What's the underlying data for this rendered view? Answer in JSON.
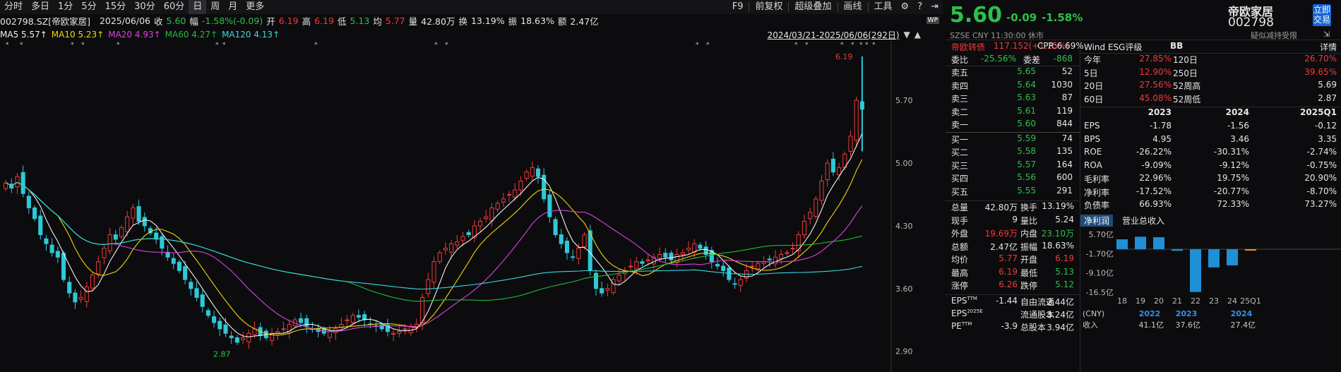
{
  "toolbar": {
    "left": [
      "分时",
      "多日",
      "1分",
      "5分",
      "15分",
      "30分",
      "60分",
      "日",
      "周",
      "月",
      "更多"
    ],
    "active": "日",
    "right": [
      "F9",
      "前复权",
      "超级叠加",
      "画线",
      "工具"
    ]
  },
  "info": {
    "code": "002798.SZ[帝欧家居]",
    "date": "2025/06/06",
    "close_label": "收",
    "close": "5.60",
    "change_label": "幅",
    "change": "-1.58%(-0.09)",
    "open_label": "开",
    "open": "6.19",
    "high_label": "高",
    "high": "6.19",
    "low_label": "低",
    "low": "5.13",
    "avg_label": "均",
    "avg": "5.77",
    "vol_label": "量",
    "vol": "42.80万",
    "turn_label": "换",
    "turn": "13.19%",
    "amp_label": "振",
    "amp": "18.63%",
    "amt_label": "额",
    "amt": "2.47亿"
  },
  "ma": {
    "ma5": "MA5 5.57↑",
    "ma10": "MA10 5.23↑",
    "ma20": "MA20 4.93↑",
    "ma60": "MA60 4.27↑",
    "ma120": "MA120 4.13↑",
    "range": "2024/03/21-2025/06/06(292日)",
    "colors": {
      "ma5": "#f2f2f2",
      "ma10": "#f5d50a",
      "ma20": "#e040e0",
      "ma60": "#1fbf3a",
      "ma120": "#3ad6e0"
    }
  },
  "chart_data": {
    "type": "candlestick",
    "y_ticks": [
      "5.70",
      "5.00",
      "4.30",
      "3.60",
      "2.90"
    ],
    "ylim": [
      2.7,
      6.3
    ],
    "high_label": "6.19",
    "low_label": "2.87",
    "closes": [
      4.78,
      4.72,
      4.85,
      4.66,
      4.5,
      4.38,
      4.2,
      4.1,
      4.0,
      3.95,
      3.7,
      3.55,
      3.45,
      3.5,
      3.62,
      3.75,
      3.9,
      4.05,
      4.2,
      4.15,
      4.28,
      4.4,
      4.5,
      4.35,
      4.3,
      4.22,
      4.15,
      4.05,
      3.95,
      3.88,
      3.8,
      3.7,
      3.6,
      3.5,
      3.4,
      3.3,
      3.22,
      3.15,
      3.1,
      3.05,
      3.0,
      3.05,
      3.1,
      3.15,
      3.08,
      3.05,
      3.1,
      3.12,
      3.15,
      3.2,
      3.25,
      3.22,
      3.18,
      3.15,
      3.12,
      3.1,
      3.12,
      3.15,
      3.2,
      3.25,
      3.3,
      3.28,
      3.25,
      3.2,
      3.18,
      3.15,
      3.12,
      3.1,
      3.12,
      3.15,
      3.18,
      3.2,
      3.5,
      3.7,
      3.9,
      4.0,
      4.05,
      4.1,
      4.12,
      4.18,
      4.2,
      4.3,
      4.35,
      4.4,
      4.5,
      4.55,
      4.6,
      4.65,
      4.7,
      4.8,
      4.9,
      4.95,
      4.85,
      4.6,
      4.4,
      4.2,
      4.1,
      4.0,
      3.95,
      4.05,
      4.2,
      3.8,
      3.6,
      3.55,
      3.6,
      3.7,
      3.75,
      3.8,
      3.85,
      3.9,
      3.88,
      3.92,
      3.95,
      3.98,
      3.95,
      3.92,
      3.98,
      4.0,
      4.05,
      4.1,
      4.05,
      3.98,
      3.9,
      3.85,
      3.8,
      3.7,
      3.65,
      3.7,
      3.8,
      3.85,
      3.88,
      3.9,
      3.92,
      3.95,
      3.98,
      4.0,
      4.05,
      4.2,
      4.35,
      4.45,
      4.6,
      4.8,
      5.0,
      4.9,
      4.95,
      5.1,
      5.3,
      5.7,
      5.6
    ],
    "series": [
      {
        "name": "MA5",
        "color": "#f2f2f2"
      },
      {
        "name": "MA10",
        "color": "#f5d50a"
      },
      {
        "name": "MA20",
        "color": "#e040e0"
      },
      {
        "name": "MA60",
        "color": "#1fbf3a"
      },
      {
        "name": "MA120",
        "color": "#3ad6e0"
      }
    ]
  },
  "quote": {
    "name": "帝欧家居",
    "code": "002798",
    "price": "5.60",
    "change": "-0.09",
    "pct": "-1.58%",
    "meta": "SZSE  CNY  11:30:00  休市",
    "notice": "疑似减持受限",
    "trade_btn": "立即交易"
  },
  "book": {
    "bond_label": "帝欧转债",
    "bond_val": "117.152(+1.25%)",
    "cpr": "CPR:6.69%",
    "webi_label": "委比",
    "webi": "-25.56%",
    "weicha_label": "委差",
    "weicha": "-868",
    "asks": [
      {
        "label": "卖五",
        "price": "5.65",
        "vol": "52"
      },
      {
        "label": "卖四",
        "price": "5.64",
        "vol": "1030"
      },
      {
        "label": "卖三",
        "price": "5.63",
        "vol": "87"
      },
      {
        "label": "卖二",
        "price": "5.61",
        "vol": "119"
      },
      {
        "label": "卖一",
        "price": "5.60",
        "vol": "844"
      }
    ],
    "bids": [
      {
        "label": "买一",
        "price": "5.59",
        "vol": "74"
      },
      {
        "label": "买二",
        "price": "5.58",
        "vol": "135"
      },
      {
        "label": "买三",
        "price": "5.57",
        "vol": "164"
      },
      {
        "label": "买四",
        "price": "5.56",
        "vol": "600"
      },
      {
        "label": "买五",
        "price": "5.55",
        "vol": "291"
      }
    ]
  },
  "stats": [
    {
      "l": "总量",
      "v": "42.80万",
      "vc": "white",
      "l2": "换手",
      "v2": "13.19%",
      "v2c": "white"
    },
    {
      "l": "现手",
      "v": "9",
      "vc": "white",
      "l2": "量比",
      "v2": "5.24",
      "v2c": "white"
    },
    {
      "l": "外盘",
      "v": "19.69万",
      "vc": "red",
      "l2": "内盘",
      "v2": "23.10万",
      "v2c": "green"
    },
    {
      "l": "总额",
      "v": "2.47亿",
      "vc": "white",
      "l2": "振幅",
      "v2": "18.63%",
      "v2c": "white"
    },
    {
      "l": "均价",
      "v": "5.77",
      "vc": "red",
      "l2": "开盘",
      "v2": "6.19",
      "v2c": "red"
    },
    {
      "l": "最高",
      "v": "6.19",
      "vc": "red",
      "l2": "最低",
      "v2": "5.13",
      "v2c": "green"
    },
    {
      "l": "涨停",
      "v": "6.26",
      "vc": "red",
      "l2": "跌停",
      "v2": "5.12",
      "v2c": "green"
    }
  ],
  "eps_block": [
    {
      "l": "EPS",
      "sup": "TTM",
      "v": "-1.44",
      "l2": "自由流通",
      "v2": "2.44亿"
    },
    {
      "l": "EPS",
      "sup": "2025E",
      "v": "",
      "l2": "流通股本",
      "v2": "3.24亿"
    },
    {
      "l": "PE",
      "sup": "TTM",
      "v": "-3.9",
      "l2": "总股本",
      "v2": "3.94亿"
    }
  ],
  "esg": {
    "label": "Wind ESG评级",
    "rating": "BB",
    "detail": "详情"
  },
  "perf": [
    {
      "l": "今年",
      "v": "27.85%",
      "l2": "120日",
      "v2": "26.70%",
      "c2": "red"
    },
    {
      "l": "5日",
      "v": "12.90%",
      "l2": "250日",
      "v2": "39.65%",
      "c2": "red"
    },
    {
      "l": "20日",
      "v": "27.56%",
      "l2": "52周高",
      "v2": "5.69",
      "c2": "white"
    },
    {
      "l": "60日",
      "v": "45.08%",
      "l2": "52周低",
      "v2": "2.87",
      "c2": "white"
    }
  ],
  "fin": {
    "headers": [
      "2023",
      "2024",
      "2025Q1"
    ],
    "rows": [
      {
        "l": "EPS",
        "v": [
          "-1.78",
          "-1.56",
          "-0.12"
        ]
      },
      {
        "l": "BPS",
        "v": [
          "4.95",
          "3.46",
          "3.35"
        ]
      },
      {
        "l": "ROE",
        "v": [
          "-26.22%",
          "-30.31%",
          "-2.74%"
        ]
      },
      {
        "l": "ROA",
        "v": [
          "-9.09%",
          "-9.12%",
          "-0.75%"
        ]
      },
      {
        "l": "毛利率",
        "v": [
          "22.96%",
          "19.75%",
          "20.90%"
        ]
      },
      {
        "l": "净利率",
        "v": [
          "-17.52%",
          "-20.77%",
          "-8.70%"
        ]
      },
      {
        "l": "负债率",
        "v": [
          "66.93%",
          "72.33%",
          "73.27%"
        ]
      }
    ]
  },
  "mini": {
    "tabs": [
      "净利润",
      "营业总收入"
    ],
    "y_ticks": [
      "5.70亿",
      "-1.70亿",
      "-9.10亿",
      "-16.5亿"
    ],
    "x_ticks": [
      "18",
      "19",
      "20",
      "21",
      "22",
      "23",
      "24",
      "25Q1"
    ],
    "years": [
      "2022",
      "2023",
      "2024"
    ],
    "values": [
      3.8,
      4.8,
      4.6,
      -0.6,
      -16.4,
      -7.0,
      -6.2,
      -0.5
    ],
    "ylim": [
      -16.5,
      5.7
    ],
    "bottom_label": "(CNY)",
    "rev_label": "收入",
    "rev": [
      "41.1亿",
      "37.6亿",
      "27.4亿"
    ]
  }
}
